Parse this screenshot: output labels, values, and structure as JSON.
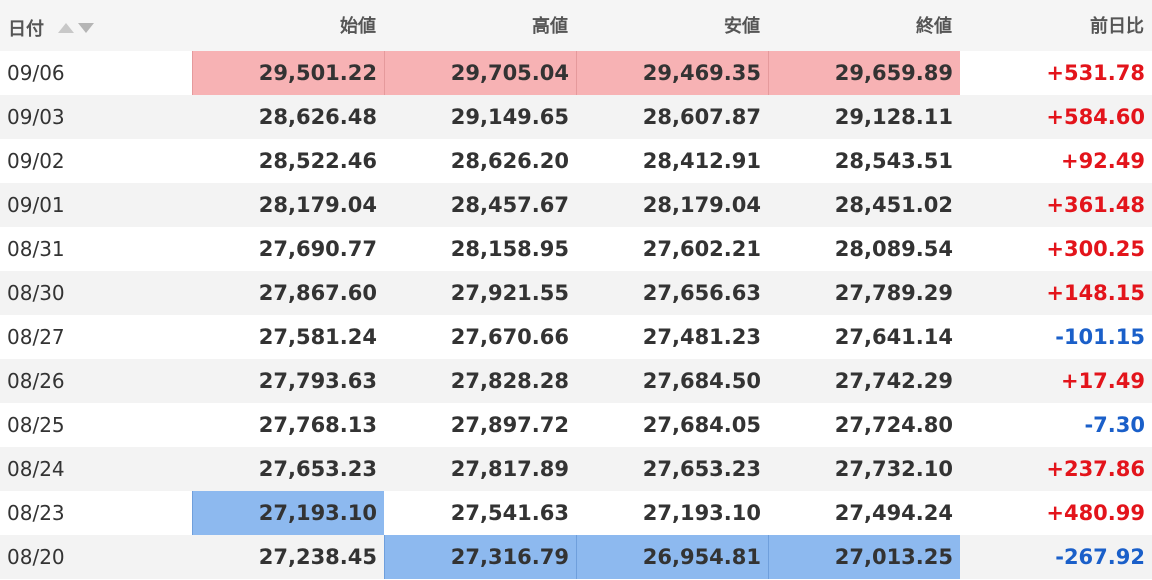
{
  "columns": {
    "date": "日付",
    "open": "始値",
    "high": "高値",
    "low": "安値",
    "close": "終値",
    "change": "前日比"
  },
  "sort_icons": [
    "sort-ascending-icon",
    "sort-descending-icon"
  ],
  "colors": {
    "positive": "#e3141b",
    "negative": "#1a5fc9",
    "highlight_high": "#f7b2b4",
    "highlight_low": "#8db9ef"
  },
  "rows": [
    {
      "date": "09/06",
      "open": "29,501.22",
      "high": "29,705.04",
      "low": "29,469.35",
      "close": "29,659.89",
      "change": "+531.78"
    },
    {
      "date": "09/03",
      "open": "28,626.48",
      "high": "29,149.65",
      "low": "28,607.87",
      "close": "29,128.11",
      "change": "+584.60"
    },
    {
      "date": "09/02",
      "open": "28,522.46",
      "high": "28,626.20",
      "low": "28,412.91",
      "close": "28,543.51",
      "change": "+92.49"
    },
    {
      "date": "09/01",
      "open": "28,179.04",
      "high": "28,457.67",
      "low": "28,179.04",
      "close": "28,451.02",
      "change": "+361.48"
    },
    {
      "date": "08/31",
      "open": "27,690.77",
      "high": "28,158.95",
      "low": "27,602.21",
      "close": "28,089.54",
      "change": "+300.25"
    },
    {
      "date": "08/30",
      "open": "27,867.60",
      "high": "27,921.55",
      "low": "27,656.63",
      "close": "27,789.29",
      "change": "+148.15"
    },
    {
      "date": "08/27",
      "open": "27,581.24",
      "high": "27,670.66",
      "low": "27,481.23",
      "close": "27,641.14",
      "change": "-101.15"
    },
    {
      "date": "08/26",
      "open": "27,793.63",
      "high": "27,828.28",
      "low": "27,684.50",
      "close": "27,742.29",
      "change": "+17.49"
    },
    {
      "date": "08/25",
      "open": "27,768.13",
      "high": "27,897.72",
      "low": "27,684.05",
      "close": "27,724.80",
      "change": "-7.30"
    },
    {
      "date": "08/24",
      "open": "27,653.23",
      "high": "27,817.89",
      "low": "27,653.23",
      "close": "27,732.10",
      "change": "+237.86"
    },
    {
      "date": "08/23",
      "open": "27,193.10",
      "high": "27,541.63",
      "low": "27,193.10",
      "close": "27,494.24",
      "change": "+480.99"
    },
    {
      "date": "08/20",
      "open": "27,238.45",
      "high": "27,316.79",
      "low": "26,954.81",
      "close": "27,013.25",
      "change": "-267.92"
    }
  ]
}
